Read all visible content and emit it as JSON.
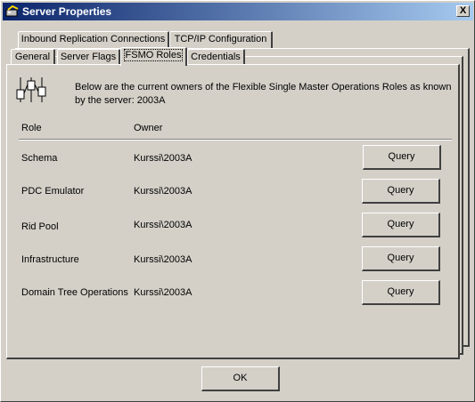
{
  "window": {
    "title": "Server Properties",
    "close_label": "X"
  },
  "tabs_row1": [
    {
      "label": "Inbound Replication Connections"
    },
    {
      "label": "TCP/IP Configuration"
    }
  ],
  "tabs_row2": [
    {
      "label": "General"
    },
    {
      "label": "Server Flags"
    },
    {
      "label": "FSMO Roles",
      "active": true
    },
    {
      "label": "Credentials"
    }
  ],
  "fsmo": {
    "description": "Below are the current owners of the Flexible Single Master Operations Roles as known by the server:  2003A",
    "columns": {
      "role": "Role",
      "owner": "Owner"
    },
    "rows": [
      {
        "role": "Schema",
        "owner": "Kurssi\\2003A",
        "button": "Query"
      },
      {
        "role": "PDC Emulator",
        "owner": "Kurssi\\2003A",
        "button": "Query"
      },
      {
        "role": "Rid Pool",
        "owner": "Kurssi\\2003A",
        "button": "Query"
      },
      {
        "role": "Infrastructure",
        "owner": "Kurssi\\2003A",
        "button": "Query"
      },
      {
        "role": "Domain Tree Operations",
        "owner": "Kurssi\\2003A",
        "button": "Query"
      }
    ]
  },
  "footer": {
    "ok_label": "OK"
  }
}
